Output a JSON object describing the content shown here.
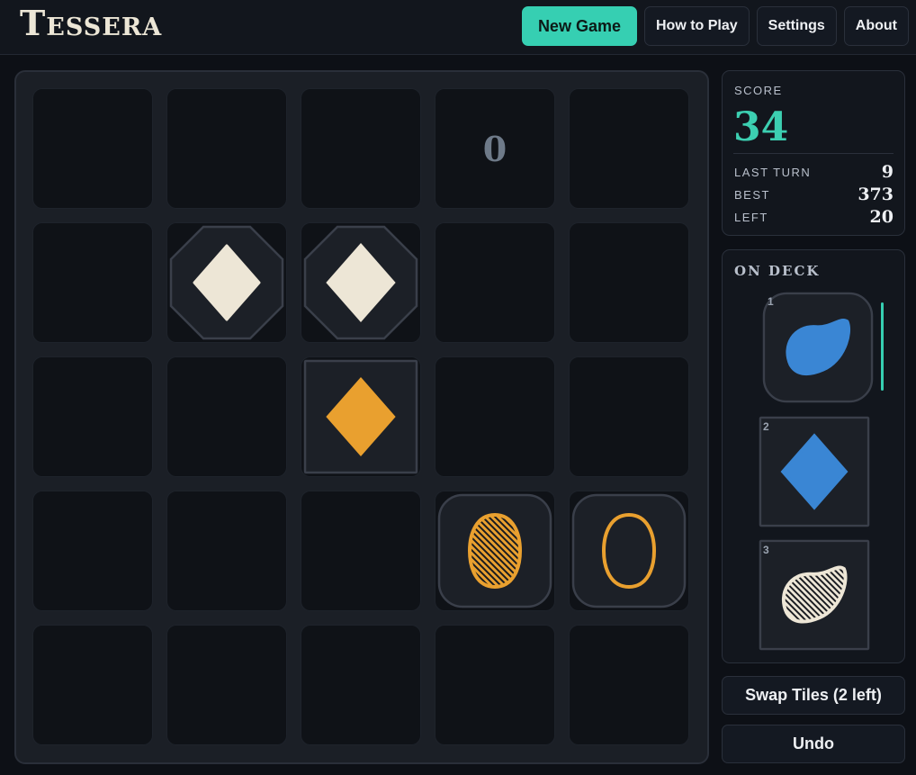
{
  "app": {
    "title": "Tessera"
  },
  "nav": {
    "new_game": "New Game",
    "how_to_play": "How to Play",
    "settings": "Settings",
    "about": "About"
  },
  "score": {
    "label": "SCORE",
    "value": "34",
    "last_turn_label": "LAST TURN",
    "last_turn_value": "9",
    "best_label": "BEST",
    "best_value": "373",
    "left_label": "LEFT",
    "left_value": "20"
  },
  "board": {
    "rows": 5,
    "cols": 5,
    "tiles": [
      {
        "row": 0,
        "col": 3,
        "kind": "zero",
        "text": "0"
      },
      {
        "row": 1,
        "col": 1,
        "frame": "octagon",
        "shape": "diamond",
        "fill": "solid",
        "color": "cream"
      },
      {
        "row": 1,
        "col": 2,
        "frame": "octagon",
        "shape": "diamond",
        "fill": "striped",
        "color": "cream"
      },
      {
        "row": 2,
        "col": 2,
        "frame": "square",
        "shape": "diamond",
        "fill": "striped",
        "color": "orange"
      },
      {
        "row": 3,
        "col": 3,
        "frame": "rounded",
        "shape": "oval",
        "fill": "hatched",
        "color": "orange"
      },
      {
        "row": 3,
        "col": 4,
        "frame": "rounded",
        "shape": "oval",
        "fill": "outline",
        "color": "orange"
      }
    ]
  },
  "deck": {
    "title": "ON DECK",
    "items": [
      {
        "index": "1",
        "frame": "rounded",
        "shape": "blob",
        "fill": "solid",
        "color": "blue",
        "active": true
      },
      {
        "index": "2",
        "frame": "square",
        "shape": "diamond",
        "fill": "striped",
        "color": "blue"
      },
      {
        "index": "3",
        "frame": "square",
        "shape": "blob",
        "fill": "hatched",
        "color": "cream"
      }
    ]
  },
  "actions": {
    "swap": "Swap Tiles (2 left)",
    "undo": "Undo"
  },
  "colors": {
    "cream": "#ede6d6",
    "orange": "#e9a02f",
    "blue": "#3a86d4",
    "accent": "#36cfb2",
    "stroke": "#191b20"
  }
}
